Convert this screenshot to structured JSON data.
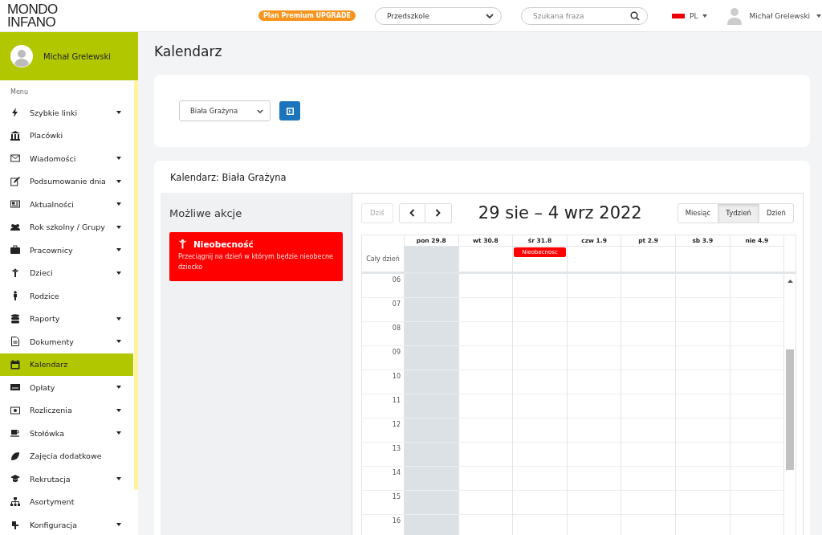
{
  "header": {
    "logo": [
      "MONDO",
      "INFANO"
    ],
    "premium_badge": "Plan Premium UPGRADE",
    "institution_select": "Przedszkole",
    "search": {
      "placeholder": "Szukana fraza"
    },
    "language": "PL",
    "user": "Michał Grelewski"
  },
  "sidebar": {
    "profile_name": "Michał Grelewski",
    "menu_label": "Menu",
    "items": [
      {
        "label": "Szybkie linki",
        "expandable": true,
        "selected": false
      },
      {
        "label": "Placówki",
        "expandable": false,
        "selected": false
      },
      {
        "label": "Wiadomości",
        "expandable": true,
        "selected": false
      },
      {
        "label": "Podsumowanie dnia",
        "expandable": true,
        "selected": false
      },
      {
        "label": "Aktualności",
        "expandable": true,
        "selected": false
      },
      {
        "label": "Rok szkolny / Grupy",
        "expandable": true,
        "selected": false
      },
      {
        "label": "Pracownicy",
        "expandable": true,
        "selected": false
      },
      {
        "label": "Dzieci",
        "expandable": true,
        "selected": false
      },
      {
        "label": "Rodzice",
        "expandable": false,
        "selected": false
      },
      {
        "label": "Raporty",
        "expandable": true,
        "selected": false
      },
      {
        "label": "Dokumenty",
        "expandable": true,
        "selected": false
      },
      {
        "label": "Kalendarz",
        "expandable": false,
        "selected": true
      },
      {
        "label": "Opłaty",
        "expandable": true,
        "selected": false
      },
      {
        "label": "Rozliczenia",
        "expandable": true,
        "selected": false
      },
      {
        "label": "Stołówka",
        "expandable": true,
        "selected": false
      },
      {
        "label": "Zajęcia dodatkowe",
        "expandable": false,
        "selected": false
      },
      {
        "label": "Rekrutacja",
        "expandable": true,
        "selected": false
      },
      {
        "label": "Asortyment",
        "expandable": false,
        "selected": false
      },
      {
        "label": "Konfiguracja",
        "expandable": true,
        "selected": false
      }
    ]
  },
  "page_title": "Kalendarz",
  "filter": {
    "child_select": "Biała Grażyna"
  },
  "calendar_card": {
    "title": "Kalendarz: Biała Grażyna",
    "actions": {
      "title": "Możliwe akcje",
      "items": [
        {
          "title": "Nieobecność",
          "description": "Przeciągnij na dzień w którym będzie nieobecne dziecko"
        }
      ]
    },
    "toolbar": {
      "today": {
        "label": "Dziś",
        "disabled": true
      },
      "range_title": "29 sie – 4 wrz 2022",
      "views": [
        {
          "label": "Miesiąc",
          "selected": false
        },
        {
          "label": "Tydzień",
          "selected": true
        },
        {
          "label": "Dzień",
          "selected": false
        }
      ]
    },
    "days": [
      {
        "label": "pon 29.8",
        "today": true
      },
      {
        "label": "wt 30.8",
        "today": false
      },
      {
        "label": "śr 31.8",
        "today": false,
        "all_day_events": [
          {
            "label": "Nieobecnosc"
          }
        ]
      },
      {
        "label": "czw 1.9",
        "today": false
      },
      {
        "label": "pt 2.9",
        "today": false
      },
      {
        "label": "sb 3.9",
        "today": false
      },
      {
        "label": "nie 4.9",
        "today": false
      }
    ],
    "all_day_label": "Cały dzień",
    "hours": [
      "06",
      "07",
      "08",
      "09",
      "10",
      "11",
      "12",
      "13",
      "14",
      "15",
      "16"
    ]
  }
}
